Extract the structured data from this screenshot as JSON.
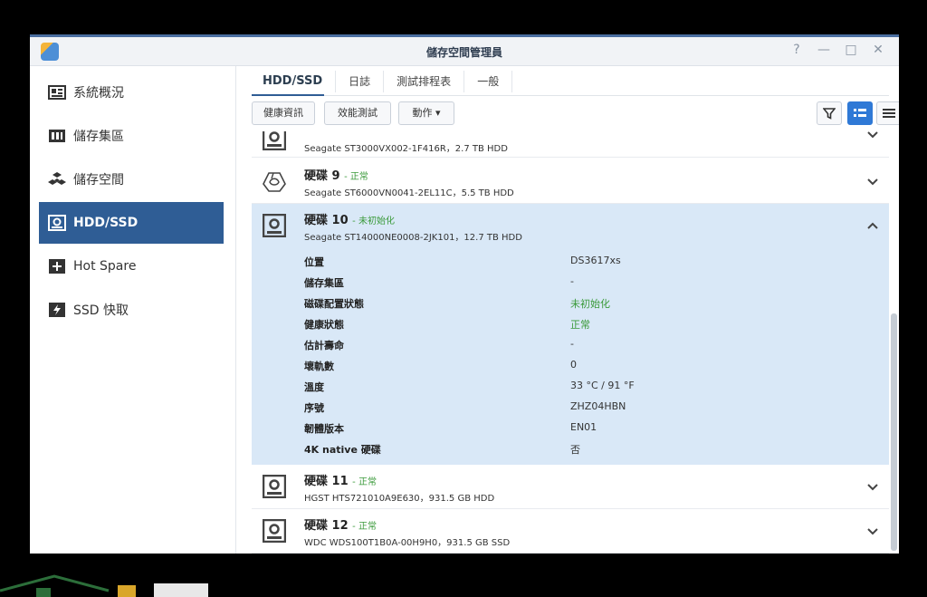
{
  "window": {
    "title": "儲存空間管理員",
    "controls": [
      "?",
      "—",
      "□",
      "✕"
    ]
  },
  "sidebar": {
    "items": [
      {
        "label": "系統概況",
        "icon": "overview-icon"
      },
      {
        "label": "儲存集區",
        "icon": "storage-pool-icon"
      },
      {
        "label": "儲存空間",
        "icon": "volume-icon"
      },
      {
        "label": "HDD/SSD",
        "icon": "disk-icon"
      },
      {
        "label": "Hot Spare",
        "icon": "hot-spare-icon"
      },
      {
        "label": "SSD 快取",
        "icon": "ssd-cache-icon"
      }
    ],
    "active_index": 3
  },
  "tabs": [
    "HDD/SSD",
    "日誌",
    "測試排程表",
    "一般"
  ],
  "toolbar": {
    "health_label": "健康資訊",
    "benchmark_label": "效能測試",
    "action_label": "動作 ▾"
  },
  "disks": [
    {
      "name_prefix": "",
      "number": "",
      "status": "",
      "model": "Seagate ST3000VX002-1F416R，2.7 TB HDD",
      "icon": "disk-icon"
    },
    {
      "name_prefix": "硬碟",
      "number": "9",
      "status": "正常",
      "model": "Seagate ST6000VN0041-2EL11C，5.5 TB HDD",
      "icon": "broken-disk-icon"
    },
    {
      "name_prefix": "硬碟",
      "number": "10",
      "status": "未初始化",
      "model": "Seagate ST14000NE0008-2JK101，12.7 TB HDD",
      "icon": "disk-icon"
    },
    {
      "name_prefix": "硬碟",
      "number": "11",
      "status": "正常",
      "model": "HGST HTS721010A9E630，931.5 GB HDD",
      "icon": "disk-icon"
    },
    {
      "name_prefix": "硬碟",
      "number": "12",
      "status": "正常",
      "model": "WDC WDS100T1B0A-00H9H0，931.5 GB SSD",
      "icon": "disk-icon"
    }
  ],
  "details": [
    {
      "label": "位置",
      "value": "DS3617xs",
      "color": "#333333"
    },
    {
      "label": "儲存集區",
      "value": "-",
      "color": "#333333"
    },
    {
      "label": "磁碟配置狀態",
      "value": "未初始化",
      "color": "#3a9a3a"
    },
    {
      "label": "健康狀態",
      "value": "正常",
      "color": "#3a9a3a"
    },
    {
      "label": "估計壽命",
      "value": "-",
      "color": "#333333"
    },
    {
      "label": "壞軌數",
      "value": "0",
      "color": "#333333"
    },
    {
      "label": "溫度",
      "value": "33 °C / 91 °F",
      "color": "#333333"
    },
    {
      "label": "序號",
      "value": "ZHZ04HBN",
      "color": "#333333"
    },
    {
      "label": "韌體版本",
      "value": "EN01",
      "color": "#333333"
    },
    {
      "label": "4K native 硬碟",
      "value": "否",
      "color": "#333333"
    }
  ],
  "colors": {
    "accent": "#2f5d95",
    "status_ok": "#3a9a3a",
    "expanded_bg": "#d9e8f7"
  }
}
